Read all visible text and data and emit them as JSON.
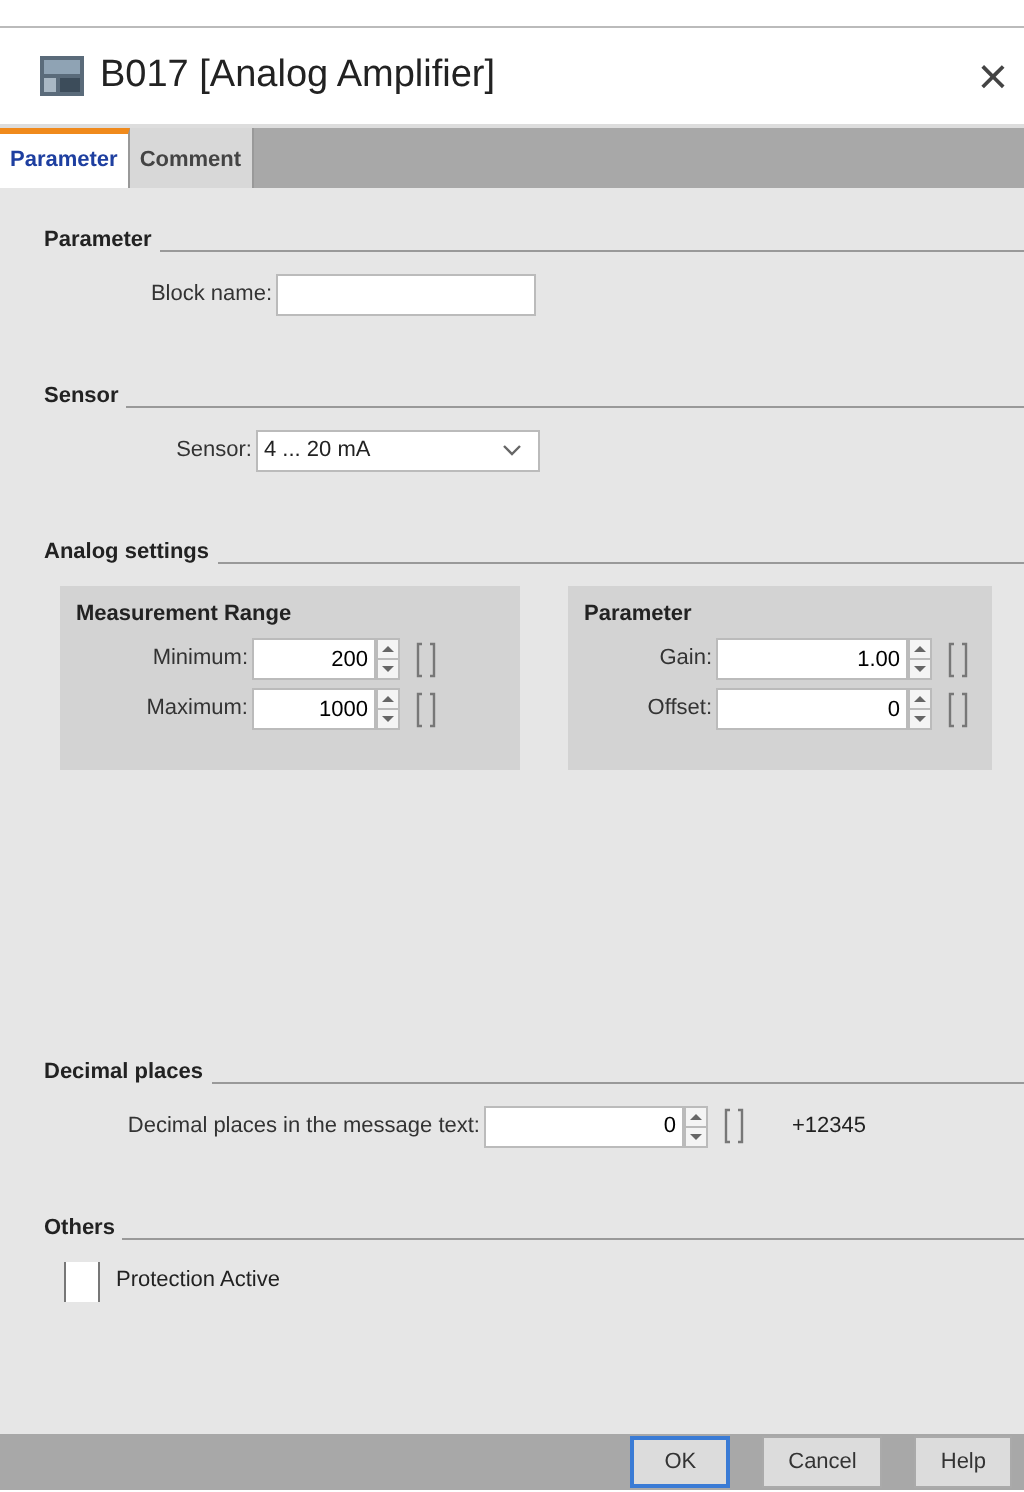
{
  "window": {
    "title": "B017 [Analog Amplifier]",
    "close": "×"
  },
  "tabs": [
    {
      "label": "Parameter",
      "selected": true
    },
    {
      "label": "Comment",
      "selected": false
    }
  ],
  "sections": [
    {
      "kind": "plain",
      "heading": "Parameter",
      "rows": [
        {
          "kind": "text",
          "label": "Block name:"
        }
      ]
    },
    {
      "kind": "plain",
      "heading": "Sensor",
      "rows": [
        {
          "kind": "select",
          "label": "Sensor:",
          "value": "4 ... 20 mA"
        }
      ]
    },
    {
      "kind": "groups",
      "heading": "Analog settings",
      "groups": [
        {
          "title": "Measurement Range",
          "rows": [
            {
              "kind": "spin",
              "label": "Minimum:",
              "value": "200"
            },
            {
              "kind": "spin",
              "label": "Maximum:",
              "value": "1000"
            }
          ]
        },
        {
          "title": "Parameter",
          "rows": [
            {
              "kind": "spin",
              "label": "Gain:",
              "value": "1.00"
            },
            {
              "kind": "spin",
              "label": "Offset:",
              "value": "0"
            }
          ]
        }
      ]
    },
    {
      "kind": "plain",
      "heading": "Decimal places",
      "rows": [
        {
          "kind": "spin",
          "label": "Decimal places in the message text:",
          "value": "0",
          "suffix": "+12345"
        }
      ]
    },
    {
      "kind": "plain",
      "heading": "Others",
      "rows": [
        {
          "kind": "checkbox",
          "label": "Protection Active",
          "checked": false
        }
      ]
    }
  ],
  "buttons": [
    {
      "label": "OK",
      "default": true
    },
    {
      "label": "Cancel",
      "default": false
    },
    {
      "label": "Help",
      "default": false
    }
  ]
}
